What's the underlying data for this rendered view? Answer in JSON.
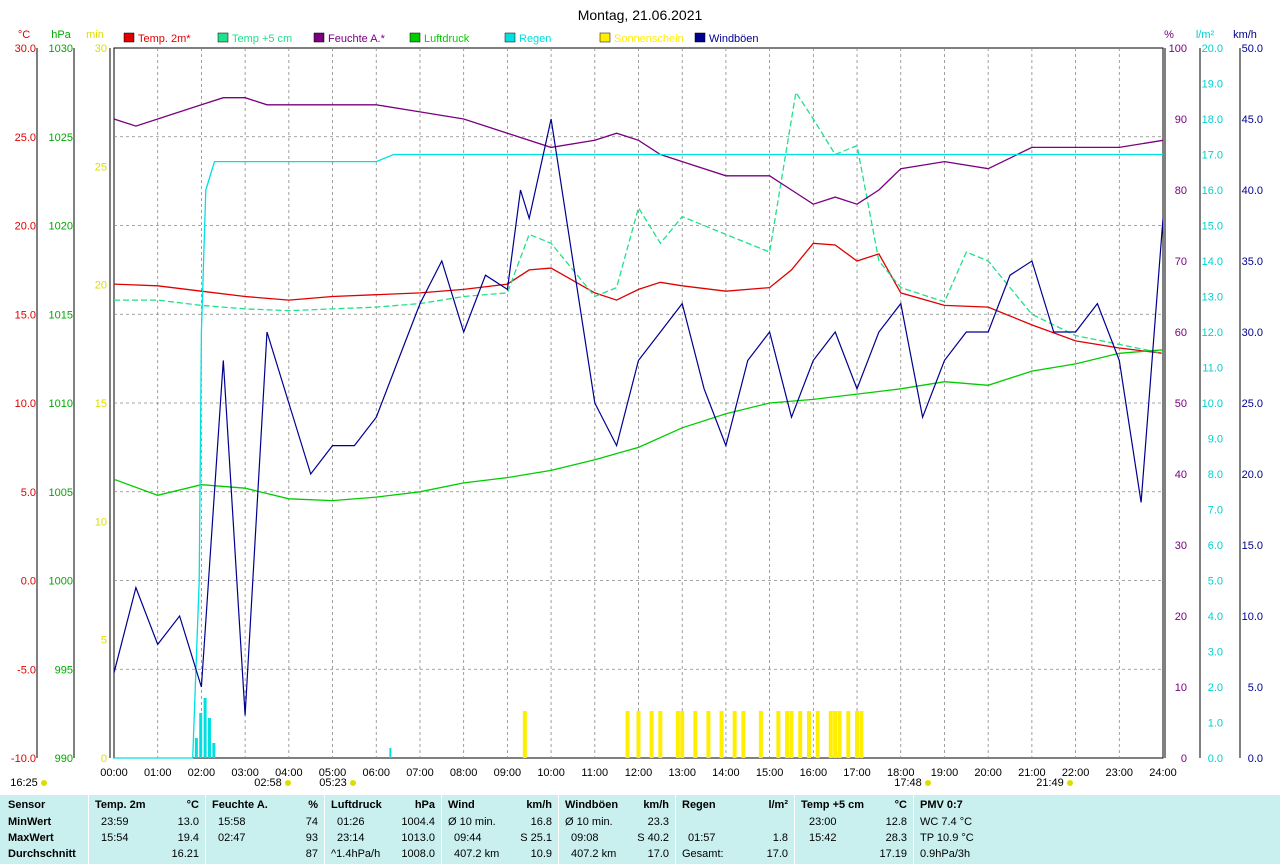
{
  "title": "Montag, 21.06.2021",
  "colors": {
    "temp2m": "#e00000",
    "temp5cm": "#20e08a",
    "humidity": "#7a0080",
    "pressure": "#00cc00",
    "rain": "#00e0e0",
    "sunshine": "#ffee00",
    "gusts": "#000090",
    "stats_bg": "#c9f0ee"
  },
  "axes": {
    "left": [
      {
        "unit": "°C",
        "ticks": [
          "30.0",
          "25.0",
          "20.0",
          "15.0",
          "10.0",
          "5.0",
          "0.0",
          "-5.0",
          "-10.0"
        ],
        "color": "#e00000"
      },
      {
        "unit": "hPa",
        "ticks": [
          "1030",
          "1025",
          "1020",
          "1015",
          "1010",
          "1005",
          "1000",
          "995",
          "990"
        ],
        "color": "#00aa00"
      },
      {
        "unit": "min",
        "ticks": [
          "30",
          "25",
          "20",
          "15",
          "10",
          "5",
          "0"
        ],
        "color": "#dddd00"
      }
    ],
    "right": [
      {
        "unit": "%",
        "ticks": [
          "100",
          "90",
          "80",
          "70",
          "60",
          "50",
          "40",
          "30",
          "20",
          "10",
          "0"
        ],
        "color": "#7a0080"
      },
      {
        "unit": "l/m²",
        "ticks": [
          "20.0",
          "19.0",
          "18.0",
          "17.0",
          "16.0",
          "15.0",
          "14.0",
          "13.0",
          "12.0",
          "11.0",
          "10.0",
          "9.0",
          "8.0",
          "7.0",
          "6.0",
          "5.0",
          "4.0",
          "3.0",
          "2.0",
          "1.0",
          "0.0"
        ],
        "color": "#00d0d0"
      },
      {
        "unit": "km/h",
        "ticks": [
          "50.0",
          "45.0",
          "40.0",
          "35.0",
          "30.0",
          "25.0",
          "20.0",
          "15.0",
          "10.0",
          "5.0",
          "0.0"
        ],
        "color": "#000090"
      }
    ],
    "x_ticks": [
      "00:00",
      "01:00",
      "02:00",
      "03:00",
      "04:00",
      "05:00",
      "06:00",
      "07:00",
      "08:00",
      "09:00",
      "10:00",
      "11:00",
      "12:00",
      "13:00",
      "14:00",
      "15:00",
      "16:00",
      "17:00",
      "18:00",
      "19:00",
      "20:00",
      "21:00",
      "22:00",
      "23:00",
      "24:00"
    ]
  },
  "events": [
    {
      "label": "16:25",
      "icon": "moonrise-icon"
    },
    {
      "label": "02:58",
      "icon": "moonset-icon"
    },
    {
      "label": "05:23",
      "icon": "sunrise-icon"
    },
    {
      "label": "17:48",
      "icon": "twilight-icon"
    },
    {
      "label": "21:49",
      "icon": "sunset-icon"
    }
  ],
  "chart_data": {
    "type": "line",
    "title": "Montag, 21.06.2021",
    "x_unit": "hour of day",
    "xlim": [
      0,
      24
    ],
    "series": [
      {
        "name": "Temp. 2m*",
        "axis": "°C",
        "ylim": [
          -10,
          30
        ],
        "x": [
          0,
          1,
          2,
          3,
          4,
          5,
          6,
          7,
          8,
          9,
          9.5,
          10,
          11,
          11.5,
          12,
          12.5,
          13,
          14,
          15,
          15.5,
          16,
          16.5,
          17,
          17.5,
          18,
          19,
          20,
          21,
          22,
          23,
          24
        ],
        "values": [
          16.7,
          16.6,
          16.3,
          16.0,
          15.8,
          16.0,
          16.1,
          16.2,
          16.4,
          16.7,
          17.5,
          17.6,
          16.2,
          15.8,
          16.4,
          16.8,
          16.6,
          16.3,
          16.5,
          17.5,
          19.0,
          18.9,
          18.0,
          18.4,
          16.2,
          15.5,
          15.4,
          14.4,
          13.5,
          13.1,
          12.8
        ]
      },
      {
        "name": "Temp +5 cm",
        "axis": "°C",
        "ylim": [
          -10,
          30
        ],
        "x": [
          0,
          1,
          2,
          3,
          4,
          5,
          6,
          7,
          8,
          9,
          9.5,
          10,
          11,
          11.5,
          12,
          12.5,
          13,
          14,
          15,
          15.3,
          15.6,
          16,
          16.5,
          17,
          17.5,
          18,
          19,
          19.5,
          20,
          21,
          22,
          23,
          24
        ],
        "values": [
          15.8,
          15.8,
          15.5,
          15.3,
          15.2,
          15.3,
          15.4,
          15.6,
          16.0,
          16.2,
          19.5,
          19.0,
          16.0,
          16.5,
          21.0,
          19.0,
          20.5,
          19.5,
          18.5,
          23.0,
          27.5,
          26.0,
          24.0,
          24.5,
          18.0,
          16.5,
          15.7,
          18.5,
          18.0,
          15.0,
          13.8,
          13.3,
          12.8
        ]
      },
      {
        "name": "Feuchte A.*",
        "axis": "%",
        "ylim": [
          0,
          100
        ],
        "x": [
          0,
          0.5,
          1,
          2,
          2.5,
          3,
          3.5,
          4,
          5,
          6,
          7,
          8,
          9,
          10,
          11,
          11.5,
          12,
          12.5,
          13,
          14,
          15,
          15.5,
          16,
          16.5,
          17,
          17.5,
          18,
          19,
          20,
          21,
          22,
          23,
          24
        ],
        "values": [
          90,
          89,
          90,
          92,
          93,
          93,
          92,
          92,
          92,
          92,
          91,
          90,
          88,
          86,
          87,
          88,
          87,
          85,
          84,
          82,
          82,
          80,
          78,
          79,
          78,
          80,
          83,
          84,
          83,
          86,
          86,
          86,
          87
        ]
      },
      {
        "name": "Luftdruck",
        "axis": "hPa",
        "ylim": [
          990,
          1030
        ],
        "x": [
          0,
          1,
          2,
          3,
          4,
          5,
          6,
          7,
          8,
          9,
          10,
          11,
          12,
          13,
          14,
          15,
          16,
          17,
          18,
          19,
          20,
          21,
          22,
          23,
          24
        ],
        "values": [
          1005.7,
          1004.8,
          1005.4,
          1005.2,
          1004.6,
          1004.5,
          1004.7,
          1005.0,
          1005.5,
          1005.8,
          1006.2,
          1006.8,
          1007.5,
          1008.6,
          1009.4,
          1010.0,
          1010.2,
          1010.5,
          1010.8,
          1011.2,
          1011.0,
          1011.8,
          1012.2,
          1012.8,
          1013.0
        ]
      },
      {
        "name": "Regen",
        "axis": "l/m²",
        "ylim": [
          0,
          20
        ],
        "x": [
          0,
          1.8,
          1.95,
          2.0,
          2.1,
          2.3,
          2.5,
          3,
          4,
          5,
          6,
          6.4,
          7,
          8,
          9,
          10,
          11,
          12,
          13,
          14,
          15,
          16,
          17,
          18,
          19,
          20,
          21,
          22,
          23,
          24
        ],
        "values": [
          0,
          0,
          5,
          12,
          16,
          16.8,
          16.8,
          16.8,
          16.8,
          16.8,
          16.8,
          17.0,
          17.0,
          17.0,
          17.0,
          17.0,
          17.0,
          17.0,
          17.0,
          17.0,
          17.0,
          17.0,
          17.0,
          17.0,
          17.0,
          17.0,
          17.0,
          17.0,
          17.0,
          17.0
        ]
      },
      {
        "name": "Sonnenschein",
        "axis": "min",
        "ylim": [
          0,
          30
        ],
        "x": [
          9.4,
          11.75,
          12,
          12.3,
          12.5,
          12.9,
          13,
          13.3,
          13.6,
          13.9,
          14.2,
          14.4,
          14.8,
          15.2,
          15.4,
          15.5,
          15.7,
          15.9,
          16.1,
          16.4,
          16.5,
          16.6,
          16.8,
          17.0,
          17.1
        ],
        "values": [
          2,
          2,
          2,
          2,
          2,
          2,
          2,
          2,
          2,
          2,
          2,
          2,
          2,
          2,
          2,
          2,
          2,
          2,
          2,
          2,
          2,
          2,
          2,
          2,
          2
        ]
      },
      {
        "name": "Windböen",
        "axis": "km/h",
        "ylim": [
          0,
          50
        ],
        "x": [
          0,
          0.5,
          1,
          1.5,
          2,
          2.5,
          3,
          3.5,
          4,
          4.5,
          5,
          5.5,
          6,
          6.5,
          7,
          7.5,
          8,
          8.5,
          9,
          9.3,
          9.5,
          10,
          10.5,
          11,
          11.5,
          12,
          12.5,
          13,
          13.5,
          14,
          14.5,
          15,
          15.5,
          16,
          16.5,
          17,
          17.5,
          18,
          18.5,
          19,
          19.5,
          20,
          20.5,
          21,
          21.5,
          22,
          22.5,
          23,
          23.5,
          24
        ],
        "values": [
          6,
          12,
          8,
          10,
          5,
          28,
          3,
          30,
          25,
          20,
          22,
          22,
          24,
          28,
          32,
          35,
          30,
          34,
          33,
          40,
          38,
          45,
          35,
          25,
          22,
          28,
          30,
          32,
          26,
          22,
          28,
          30,
          24,
          28,
          30,
          26,
          30,
          32,
          24,
          28,
          30,
          30,
          34,
          35,
          30,
          30,
          32,
          28,
          18,
          38
        ]
      }
    ],
    "stats": {
      "headers": [
        "Sensor",
        "Temp. 2m",
        "°C",
        "Feuchte A.",
        "%",
        "Luftdruck",
        "hPa",
        "Wind",
        "km/h",
        "Windböen",
        "km/h",
        "Regen",
        "l/m²",
        "Temp +5 cm",
        "°C",
        "PMV 0:7"
      ],
      "rows": {
        "min": {
          "label": "MinWert",
          "temp2m_time": "23:59",
          "temp2m": "13.0",
          "hum_time": "15:58",
          "hum": "74",
          "press_time": "01:26",
          "press": "1004.4",
          "wind_label": "Ø 10 min.",
          "wind": "16.8",
          "gust_label": "Ø 10 min.",
          "gust": "23.3",
          "rain_time": "",
          "rain": "",
          "t5_time": "23:00",
          "t5": "12.8",
          "pmv": "WC 7.4 °C"
        },
        "max": {
          "label": "MaxWert",
          "temp2m_time": "15:54",
          "temp2m": "19.4",
          "hum_time": "02:47",
          "hum": "93",
          "press_time": "23:14",
          "press": "1013.0",
          "wind_label": "09:44",
          "wind": "S 25.1",
          "gust_label": "09:08",
          "gust": "S 40.2",
          "rain_time": "01:57",
          "rain": "1.8",
          "t5_time": "15:42",
          "t5": "28.3",
          "pmv": "TP 10.9 °C"
        },
        "avg": {
          "label": "Durchschnitt",
          "temp2m_time": "",
          "temp2m": "16.21",
          "hum_time": "",
          "hum": "87",
          "press_time": "^1.4hPa/h",
          "press": "1008.0",
          "wind_label": "407.2 km",
          "wind": "10.9",
          "gust_label": "407.2 km",
          "gust": "17.0",
          "rain_time": "Gesamt:",
          "rain": "17.0",
          "t5_time": "",
          "t5": "17.19",
          "pmv": "0.9hPa/3h"
        }
      }
    }
  }
}
